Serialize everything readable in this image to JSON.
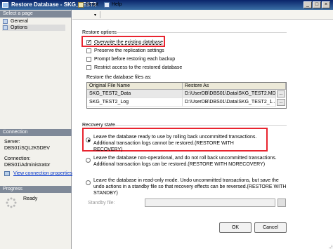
{
  "window": {
    "title": "Restore Database - SKG_TEST2"
  },
  "sidebar": {
    "select_page_header": "Select a page",
    "pages": [
      {
        "label": "General",
        "icon": "page-icon"
      },
      {
        "label": "Options",
        "icon": "page-icon"
      }
    ],
    "connection_header": "Connection",
    "server_label": "Server:",
    "server_value": "DBS01\\SQL2K5DEV",
    "connection_label": "Connection:",
    "connection_value": "DBS01\\Administrator",
    "view_connection_link": "View connection properties",
    "progress_header": "Progress",
    "progress_status": "Ready"
  },
  "toolbar": {
    "script_label": "Script",
    "help_label": "Help"
  },
  "restore_options": {
    "header": "Restore options",
    "options": [
      {
        "label": "Overwrite the existing database",
        "checked": true
      },
      {
        "label": "Preserve the replication settings",
        "checked": false
      },
      {
        "label": "Prompt before restoring each backup",
        "checked": false
      },
      {
        "label": "Restrict access to the restored database",
        "checked": false
      }
    ]
  },
  "restore_files": {
    "label": "Restore the database files as:",
    "columns": [
      "Original File Name",
      "Restore As"
    ],
    "rows": [
      {
        "original": "SKG_TEST2_Data",
        "restore_as": "D:\\UserDB\\DBS01\\Data\\SKG_TEST2.MDF"
      },
      {
        "original": "SKG_TEST2_Log",
        "restore_as": "D:\\UserDB\\DBS01\\Data\\SKG_TEST2_1..."
      }
    ]
  },
  "recovery_state": {
    "header": "Recovery state",
    "options": [
      {
        "text": "Leave the database ready to use by rolling back uncommitted transactions. Additional transaction logs cannot be restored.(RESTORE WITH RECOVERY)",
        "selected": true
      },
      {
        "text": "Leave the database non-operational, and do not roll back uncommitted transactions. Additional transaction logs can be restored.(RESTORE WITH NORECOVERY)",
        "selected": false
      },
      {
        "text": "Leave the database in read-only mode. Undo uncommitted transactions, but save the undo actions in a standby file so that recovery effects can be reversed.(RESTORE WITH STANDBY)",
        "selected": false
      }
    ],
    "standby_label": "Standby file:",
    "standby_value": ""
  },
  "buttons": {
    "ok": "OK",
    "cancel": "Cancel",
    "browse": "..."
  },
  "colors": {
    "highlight": "#e8242f",
    "title_bar": "#0a246a"
  }
}
